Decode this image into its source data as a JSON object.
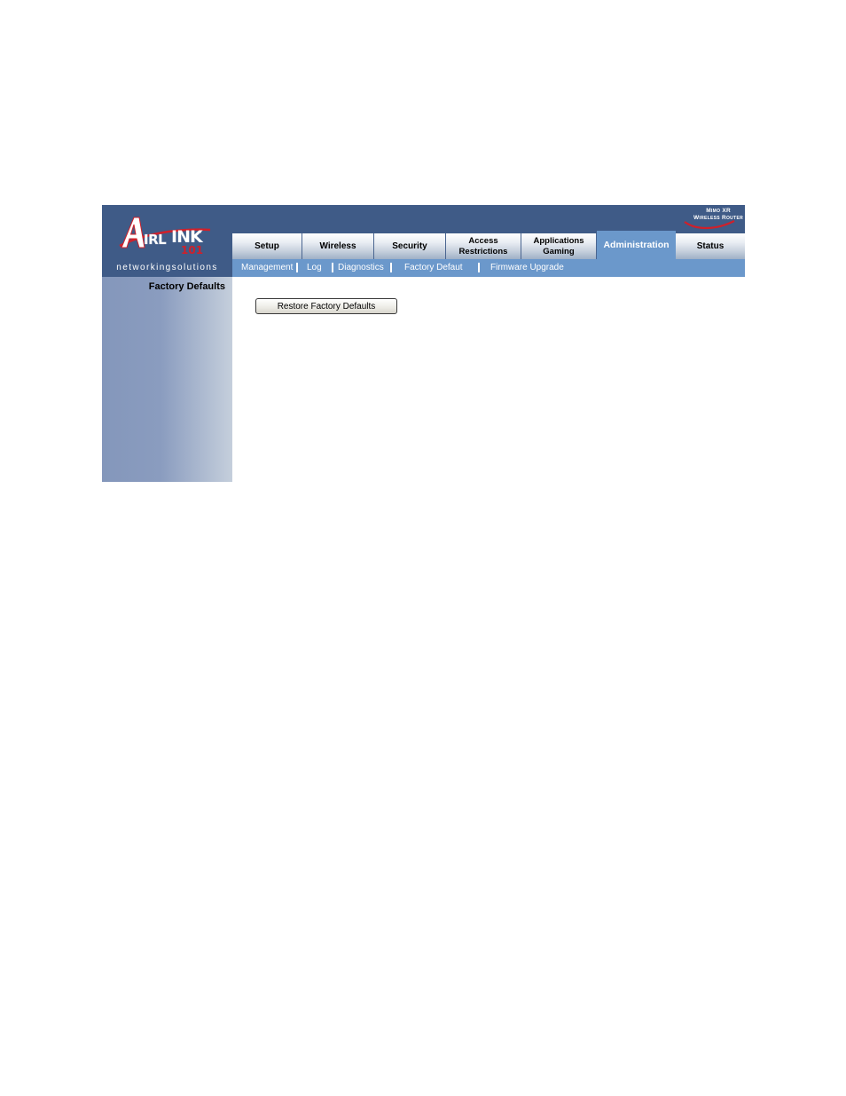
{
  "brand": {
    "logo_word": "AIRLINK",
    "logo_number": "101",
    "tagline": "networkingsolutions",
    "model_line1": "Mimo XR",
    "model_line2": "Wireless Router"
  },
  "tabs": [
    {
      "label": "Setup"
    },
    {
      "label": "Wireless"
    },
    {
      "label": "Security"
    },
    {
      "label": "Access Restrictions",
      "line1": "Access",
      "line2": "Restrictions"
    },
    {
      "label": "Applications Gaming",
      "line1": "Applications",
      "line2": "Gaming"
    },
    {
      "label": "Administration",
      "active": true
    },
    {
      "label": "Status"
    }
  ],
  "subnav": [
    {
      "label": "Management"
    },
    {
      "label": "Log"
    },
    {
      "label": "Diagnostics"
    },
    {
      "label": "Factory Defaut",
      "active": true
    },
    {
      "label": "Firmware Upgrade"
    }
  ],
  "sidebar": {
    "title": "Factory Defaults"
  },
  "content": {
    "restore_button": "Restore Factory Defaults"
  },
  "colors": {
    "header": "#3f5b87",
    "active_tab": "#6b98cb",
    "subnav": "#6b98cb",
    "logo_red": "#d0202a"
  }
}
